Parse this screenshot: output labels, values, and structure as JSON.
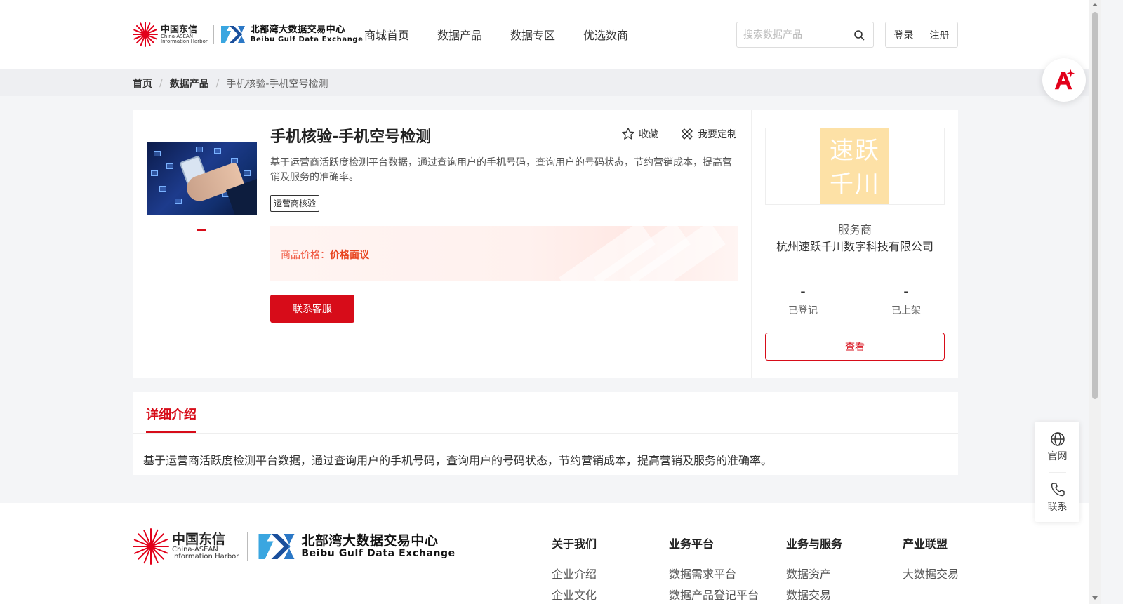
{
  "brand": {
    "cn_name": "中国东信",
    "cn_sub": "China-ASEAN",
    "cn_sub2": "Information Harbor",
    "bg_name": "北部湾大数据交易中心",
    "bg_en": "Beibu Gulf Data Exchange",
    "accent_color": "#d70c19"
  },
  "nav": {
    "items": [
      "商城首页",
      "数据产品",
      "数据专区",
      "优选数商"
    ]
  },
  "search": {
    "placeholder": "搜索数据产品",
    "icon": "search-icon"
  },
  "auth": {
    "login": "登录",
    "register": "注册"
  },
  "breadcrumb": {
    "items": [
      "首页",
      "数据产品",
      "手机核验-手机空号检测"
    ],
    "separator": "/"
  },
  "product": {
    "title": "手机核验-手机空号检测",
    "favorite_label": "收藏",
    "custom_label": "我要定制",
    "description": "基于运营商活跃度检测平台数据，通过查询用户的手机号码，查询用户的号码状态，节约营销成本，提高营销及服务的准确率。",
    "tag": "运营商核验",
    "price_label": "商品价格：",
    "price_value": "价格面议",
    "contact_button": "联系客服"
  },
  "provider": {
    "logo_line1": "速跃",
    "logo_line2": "千川",
    "logo_color": "#fde1a6",
    "label": "服务商",
    "name": "杭州速跃千川数字科技有限公司",
    "stats": [
      {
        "value": "-",
        "label": "已登记"
      },
      {
        "value": "-",
        "label": "已上架"
      }
    ],
    "view_button": "查看"
  },
  "detail": {
    "tab": "详细介绍",
    "text": "基于运营商活跃度检测平台数据，通过查询用户的手机号码，查询用户的号码状态，节约营销成本，提高营销及服务的准确率。"
  },
  "footer": {
    "columns": [
      {
        "title": "关于我们",
        "links": [
          "企业介绍",
          "企业文化"
        ]
      },
      {
        "title": "业务平台",
        "links": [
          "数据需求平台",
          "数据产品登记平台"
        ]
      },
      {
        "title": "业务与服务",
        "links": [
          "数据资产",
          "数据交易"
        ]
      },
      {
        "title": "产业联盟",
        "links": [
          "大数据交易"
        ]
      }
    ]
  },
  "float": {
    "ai_icon": "ai-assistant-icon",
    "website_label": "官网",
    "contact_label": "联系"
  }
}
